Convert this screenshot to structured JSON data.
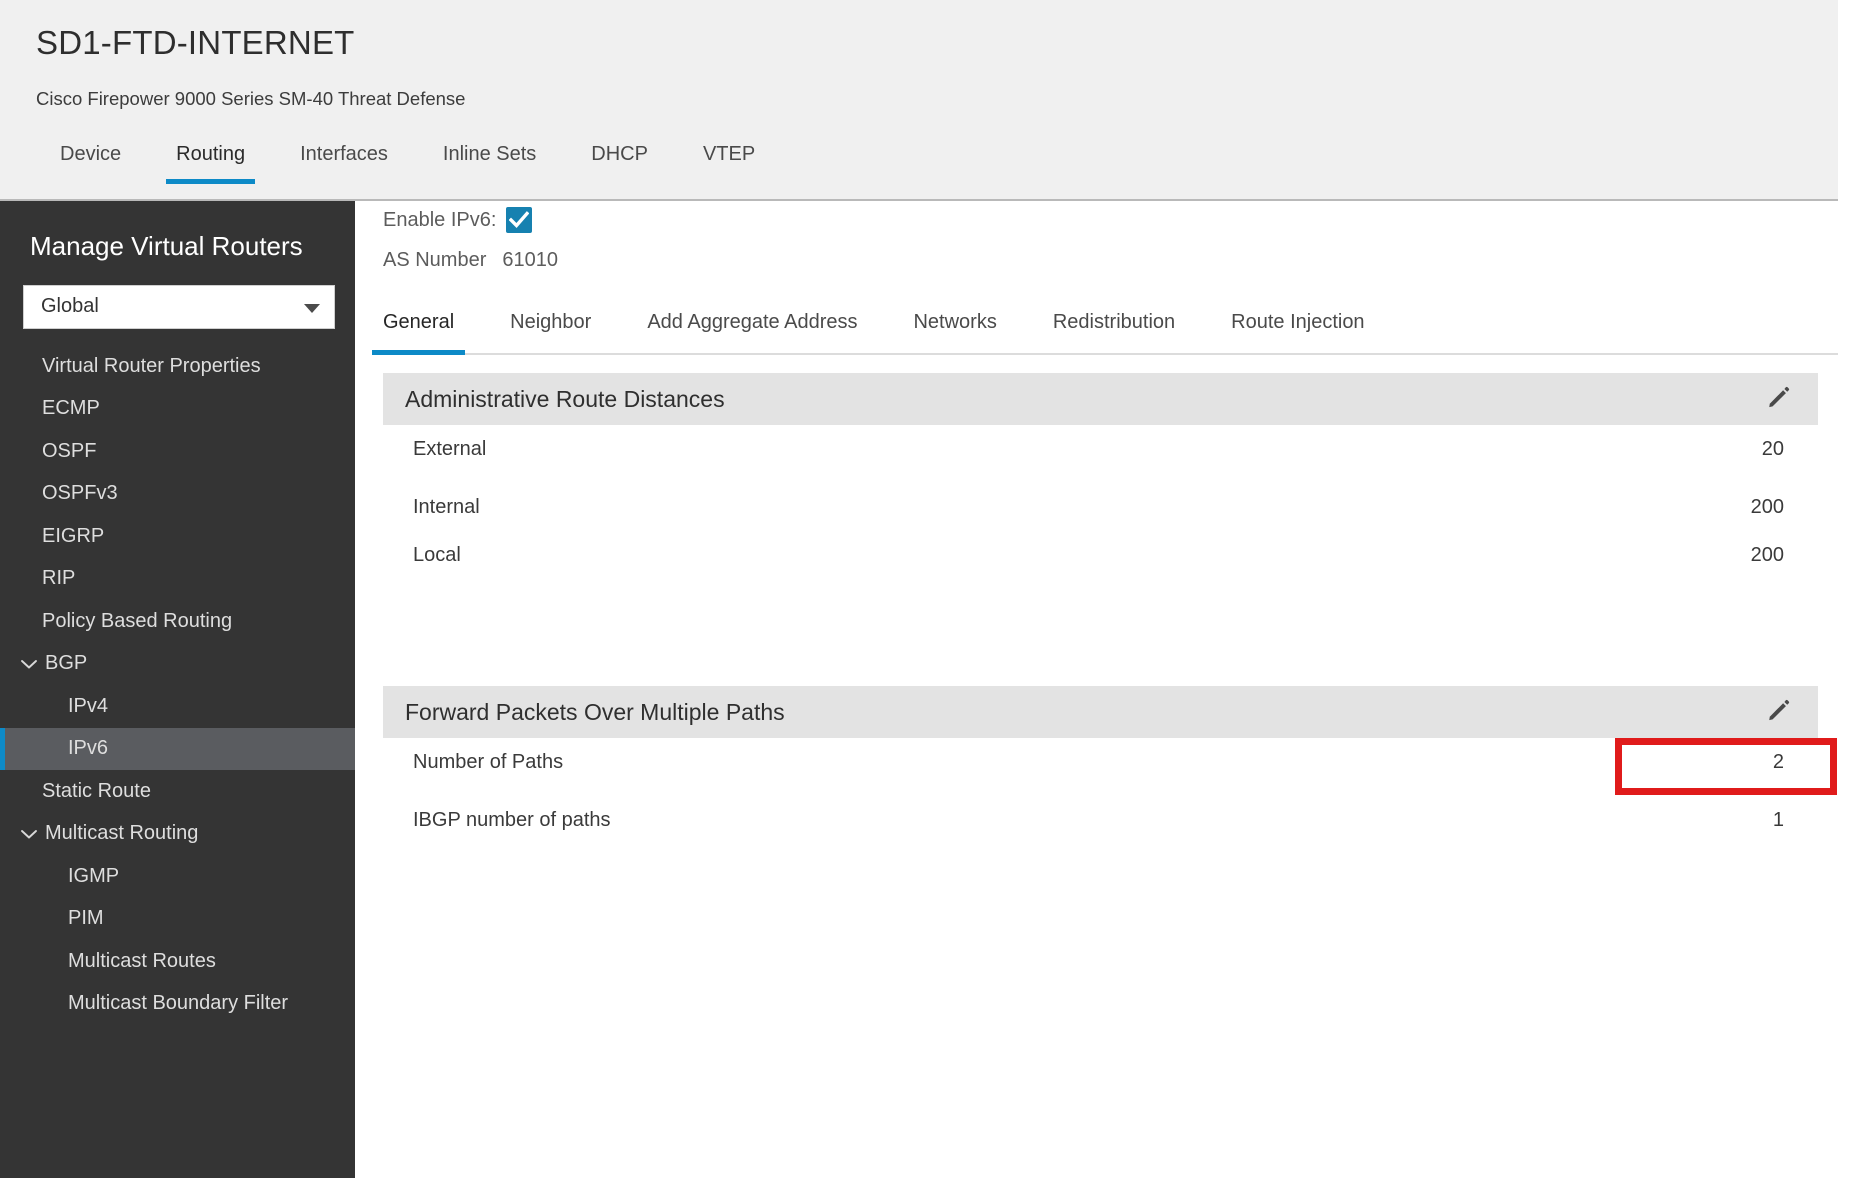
{
  "header": {
    "device_title": "SD1-FTD-INTERNET",
    "device_subtitle": "Cisco Firepower 9000 Series SM-40 Threat Defense",
    "tabs": [
      {
        "label": "Device",
        "active": false
      },
      {
        "label": "Routing",
        "active": true
      },
      {
        "label": "Interfaces",
        "active": false
      },
      {
        "label": "Inline Sets",
        "active": false
      },
      {
        "label": "DHCP",
        "active": false
      },
      {
        "label": "VTEP",
        "active": false
      }
    ]
  },
  "sidebar": {
    "heading": "Manage Virtual Routers",
    "router_select": {
      "value": "Global",
      "caret_icon": "chevron-down-icon"
    },
    "items": [
      {
        "label": "Virtual Router Properties",
        "level": 0,
        "chevron": "",
        "selected": false
      },
      {
        "label": "ECMP",
        "level": 0,
        "chevron": "",
        "selected": false
      },
      {
        "label": "OSPF",
        "level": 0,
        "chevron": "",
        "selected": false
      },
      {
        "label": "OSPFv3",
        "level": 0,
        "chevron": "",
        "selected": false
      },
      {
        "label": "EIGRP",
        "level": 0,
        "chevron": "",
        "selected": false
      },
      {
        "label": "RIP",
        "level": 0,
        "chevron": "",
        "selected": false
      },
      {
        "label": "Policy Based Routing",
        "level": 0,
        "chevron": "",
        "selected": false
      },
      {
        "label": "BGP",
        "level": 0,
        "chevron": "chevron-down-icon",
        "selected": false
      },
      {
        "label": "IPv4",
        "level": 1,
        "chevron": "",
        "selected": false
      },
      {
        "label": "IPv6",
        "level": 1,
        "chevron": "",
        "selected": true
      },
      {
        "label": "Static Route",
        "level": 0,
        "chevron": "",
        "selected": false
      },
      {
        "label": "Multicast Routing",
        "level": 0,
        "chevron": "chevron-down-icon",
        "selected": false
      },
      {
        "label": "IGMP",
        "level": 1,
        "chevron": "",
        "selected": false
      },
      {
        "label": "PIM",
        "level": 1,
        "chevron": "",
        "selected": false
      },
      {
        "label": "Multicast Routes",
        "level": 1,
        "chevron": "",
        "selected": false
      },
      {
        "label": "Multicast Boundary Filter",
        "level": 1,
        "chevron": "",
        "selected": false
      }
    ]
  },
  "content": {
    "enable_ipv6": {
      "label": "Enable IPv6:",
      "checked": true,
      "icon": "checkmark-icon"
    },
    "as_number": {
      "label": "AS Number",
      "value": "61010"
    },
    "sub_tabs": [
      {
        "label": "General",
        "active": true
      },
      {
        "label": "Neighbor",
        "active": false
      },
      {
        "label": "Add Aggregate Address",
        "active": false
      },
      {
        "label": "Networks",
        "active": false
      },
      {
        "label": "Redistribution",
        "active": false
      },
      {
        "label": "Route Injection",
        "active": false
      }
    ],
    "panels": [
      {
        "title": "Administrative Route Distances",
        "edit_icon": "pencil-icon",
        "rows": [
          {
            "key": "External",
            "value": "20"
          },
          {
            "key": "Internal",
            "value": "200"
          },
          {
            "key": "Local",
            "value": "200"
          }
        ]
      },
      {
        "title": "Forward Packets Over Multiple Paths",
        "edit_icon": "pencil-icon",
        "rows": [
          {
            "key": "Number of Paths",
            "value": "2"
          },
          {
            "key": "IBGP number of paths",
            "value": "1"
          }
        ]
      }
    ],
    "annotation": {
      "color": "#e01b1b",
      "targets_value": "2"
    }
  }
}
